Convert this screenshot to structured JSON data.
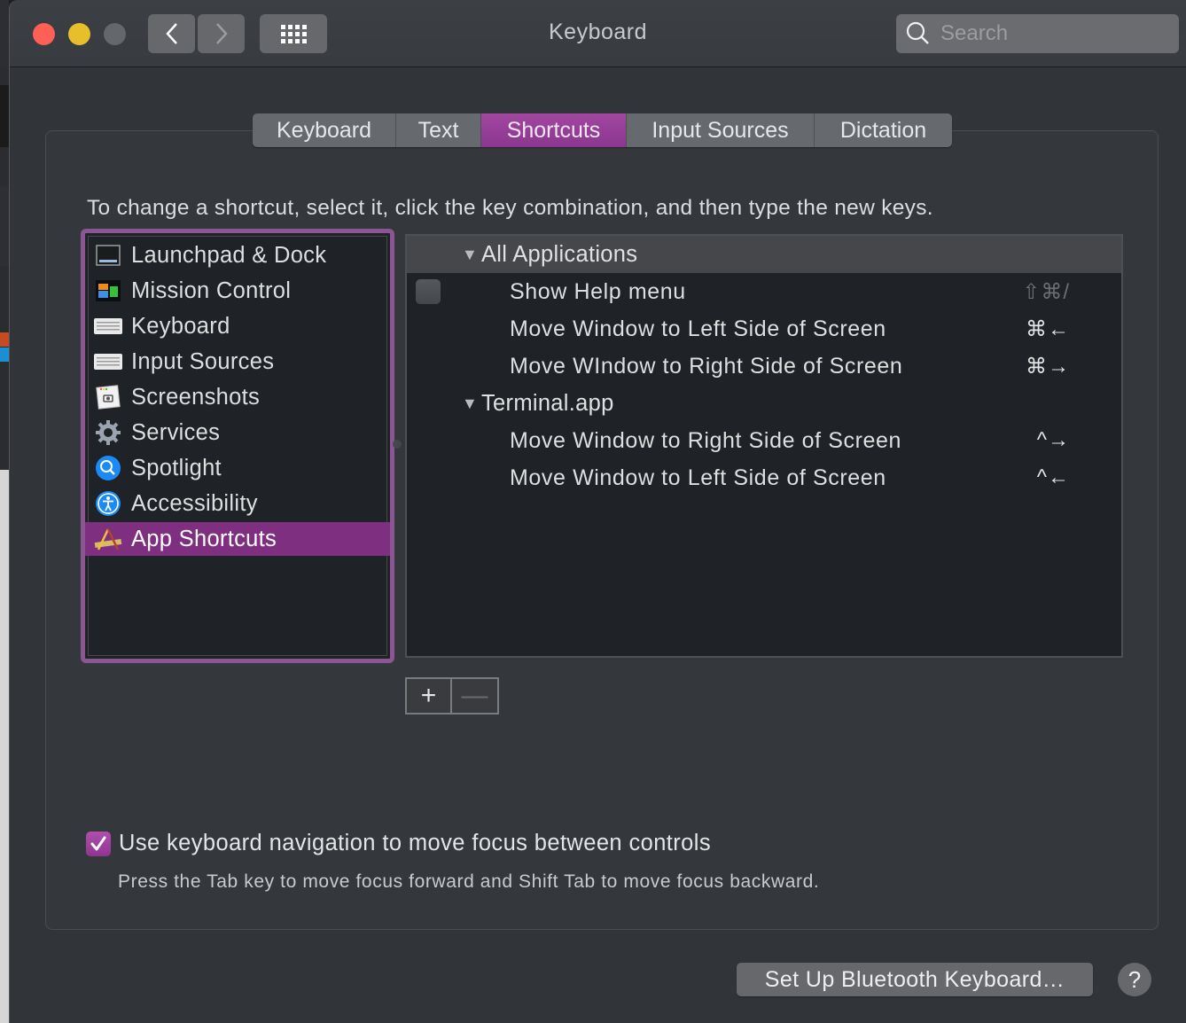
{
  "window": {
    "title": "Keyboard",
    "search_placeholder": "Search",
    "accent_color": "#8e3590"
  },
  "toolbar": {
    "back_icon": "chevron-left-icon",
    "forward_icon": "chevron-right-icon",
    "show_all_icon": "grid-icon"
  },
  "tabs": [
    {
      "label": "Keyboard",
      "active": false
    },
    {
      "label": "Text",
      "active": false
    },
    {
      "label": "Shortcuts",
      "active": true
    },
    {
      "label": "Input Sources",
      "active": false
    },
    {
      "label": "Dictation",
      "active": false
    }
  ],
  "instruction": "To change a shortcut, select it, click the key combination, and then type the new keys.",
  "categories": [
    {
      "label": "Launchpad & Dock",
      "icon": "launchpad-dock-icon",
      "selected": false
    },
    {
      "label": "Mission Control",
      "icon": "mission-control-icon",
      "selected": false
    },
    {
      "label": "Keyboard",
      "icon": "keyboard-icon",
      "selected": false
    },
    {
      "label": "Input Sources",
      "icon": "input-sources-icon",
      "selected": false
    },
    {
      "label": "Screenshots",
      "icon": "screenshots-icon",
      "selected": false
    },
    {
      "label": "Services",
      "icon": "gear-icon",
      "selected": false
    },
    {
      "label": "Spotlight",
      "icon": "spotlight-icon",
      "selected": false
    },
    {
      "label": "Accessibility",
      "icon": "accessibility-icon",
      "selected": false
    },
    {
      "label": "App Shortcuts",
      "icon": "app-shortcuts-icon",
      "selected": true
    }
  ],
  "shortcuts": {
    "groups": [
      {
        "name": "All Applications",
        "expanded": true,
        "items": [
          {
            "label": "Show Help menu",
            "keys": "⇧⌘/",
            "enabled": false,
            "has_checkbox": true
          },
          {
            "label": "Move Window to Left Side of Screen",
            "keys": "⌘←",
            "enabled": true
          },
          {
            "label": "Move WIndow to Right Side of Screen",
            "keys": "⌘→",
            "enabled": true
          }
        ]
      },
      {
        "name": "Terminal.app",
        "expanded": true,
        "items": [
          {
            "label": "Move Window to Right Side of Screen",
            "keys": "^→",
            "enabled": true
          },
          {
            "label": "Move Window to Left Side of Screen",
            "keys": "^←",
            "enabled": true
          }
        ]
      }
    ],
    "add_label": "+",
    "remove_label": "—"
  },
  "keyboard_navigation": {
    "label": "Use keyboard navigation to move focus between controls",
    "checked": true,
    "hint": "Press the Tab key to move focus forward and Shift Tab to move focus backward."
  },
  "footer": {
    "bluetooth_button": "Set Up Bluetooth Keyboard…",
    "help_label": "?"
  }
}
